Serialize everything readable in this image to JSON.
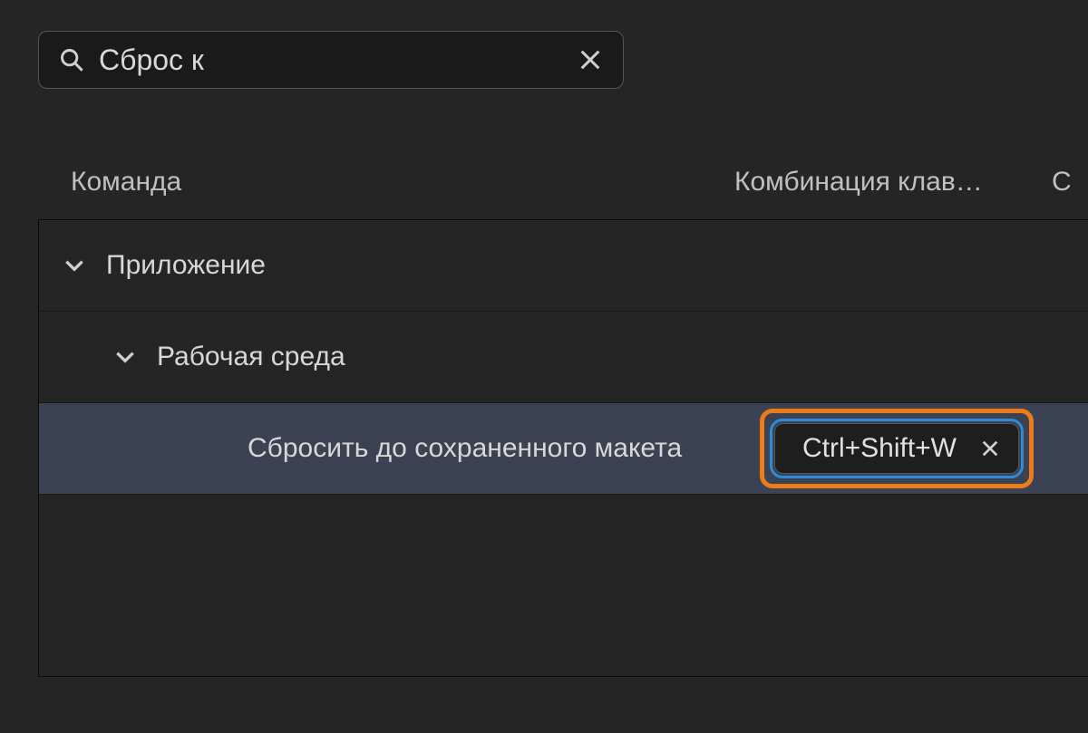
{
  "search": {
    "value": "Сброс к"
  },
  "columns": {
    "command": "Команда",
    "shortcut": "Комбинация клав…",
    "third": "С"
  },
  "tree": {
    "app": "Приложение",
    "workspace": "Рабочая среда",
    "reset_item": "Сбросить до сохраненного макета",
    "shortcut_value": "Ctrl+Shift+W"
  }
}
